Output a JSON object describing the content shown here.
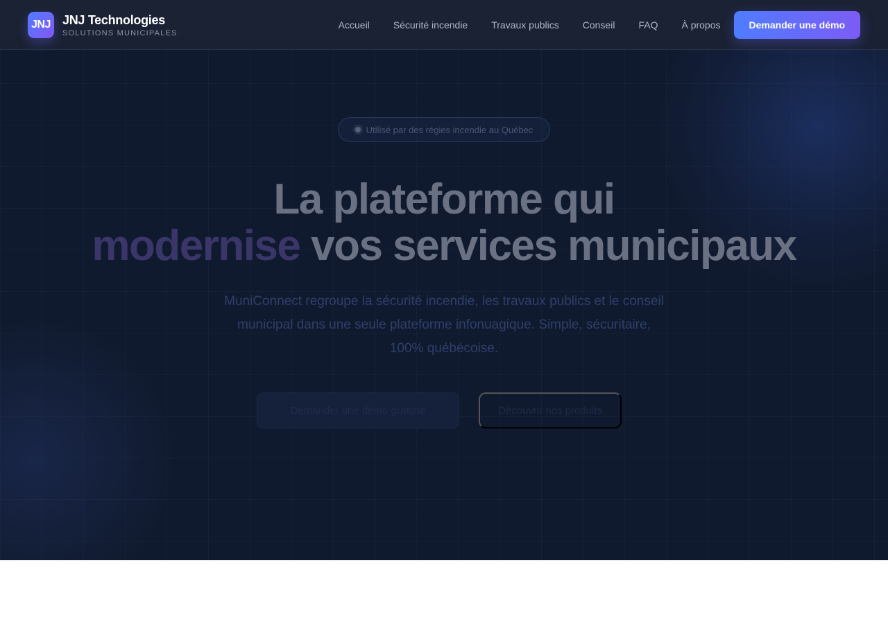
{
  "header": {
    "logo_text": "JNJ",
    "brand_name": "JNJ Technologies",
    "brand_tagline": "SOLUTIONS MUNICIPALES",
    "nav": [
      {
        "label": "Accueil"
      },
      {
        "label": "Sécurité incendie"
      },
      {
        "label": "Travaux publics"
      },
      {
        "label": "Conseil"
      },
      {
        "label": "FAQ"
      },
      {
        "label": "À propos"
      }
    ],
    "cta_label": "Demander une démo"
  },
  "hero": {
    "badge_text": "Utilisé par des régies incendie au Québec",
    "title_line1": "La plateforme qui",
    "title_accent": "modernise",
    "title_rest": " vos services municipaux",
    "subtitle": "MuniConnect regroupe la sécurité incendie, les travaux publics et le conseil municipal dans une seule plateforme infonuagique. Simple, sécuritaire, 100% québécoise.",
    "primary_button": "Demander une démo gratuite",
    "secondary_button": "Découvrir nos produits"
  },
  "colors": {
    "header_bg": "#1b2234",
    "hero_bg": "#101a2e",
    "accent_start": "#4f7cff",
    "accent_end": "#7c5cf5"
  }
}
